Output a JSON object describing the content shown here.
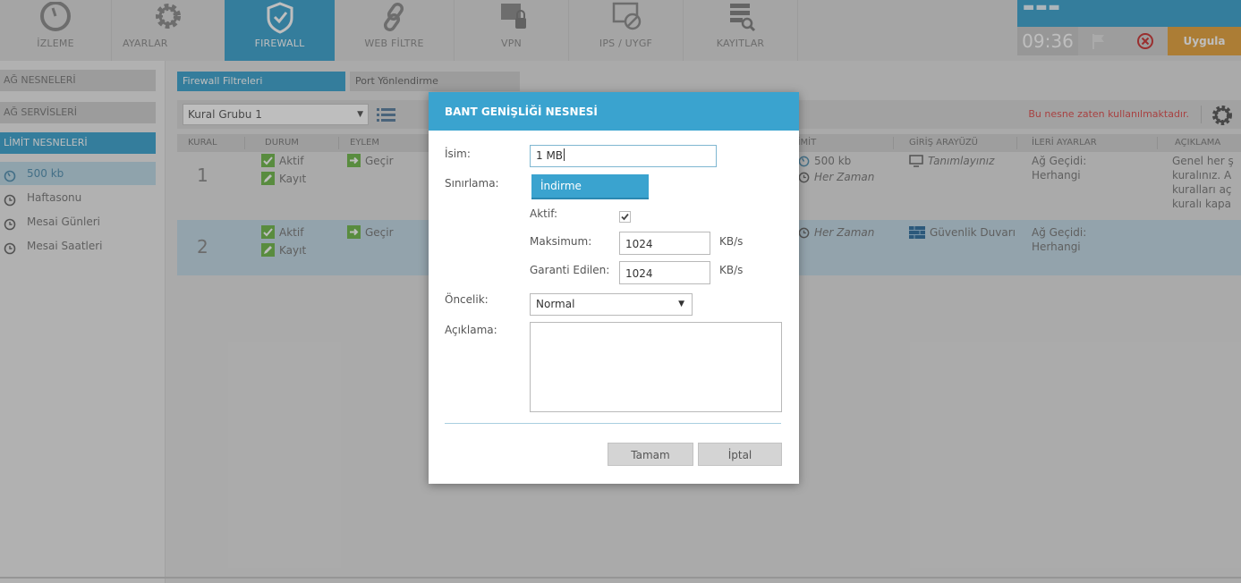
{
  "nav": {
    "tabs": [
      {
        "label": "İZLEME",
        "icon": "gauge-icon"
      },
      {
        "label": "AYARLAR",
        "icon": "gear-icon"
      },
      {
        "label": "FIREWALL",
        "icon": "shield-icon"
      },
      {
        "label": "WEB FİLTRE",
        "icon": "link-icon"
      },
      {
        "label": "VPN",
        "icon": "network-lock-icon"
      },
      {
        "label": "IPS / UYGF",
        "icon": "blocked-monitor-icon"
      },
      {
        "label": "KAYITLAR",
        "icon": "log-search-icon"
      }
    ],
    "active_tab": "FIREWALL",
    "time": "09:36",
    "apply_label": "Uygula",
    "colors": {
      "accent": "#3aa3cf",
      "apply": "#e6a33c",
      "warning": "#e04c4c"
    }
  },
  "sidebar": {
    "sections": [
      "AĞ NESNELERİ",
      "AĞ SERVİSLERİ",
      "LİMİT NESNELERİ"
    ],
    "active_section": "LİMİT NESNELERİ",
    "items": [
      {
        "label": "500 kb",
        "icon": "gauge-icon",
        "selected": true
      },
      {
        "label": "Haftasonu",
        "icon": "clock-icon",
        "selected": false
      },
      {
        "label": "Mesai Günleri",
        "icon": "clock-icon",
        "selected": false
      },
      {
        "label": "Mesai Saatleri",
        "icon": "clock-icon",
        "selected": false
      }
    ]
  },
  "main": {
    "tabs": [
      "Firewall Filtreleri",
      "Port Yönlendirme"
    ],
    "active_tab": "Firewall Filtreleri",
    "group_select": "Kural Grubu 1",
    "warning": "Bu nesne zaten kullanılmaktadır.",
    "columns": [
      "KURAL",
      "DURUM",
      "EYLEM",
      "LİMİT",
      "GİRİŞ ARAYÜZÜ",
      "İLERİ AYARLAR",
      "AÇIKLAMA"
    ],
    "rows": [
      {
        "num": "1",
        "status": "Aktif",
        "log": "Kayıt",
        "action": "Geçir",
        "limit": "500 kb",
        "schedule": "Her Zaman",
        "interface": "Tanımlayınız",
        "advanced_1": "Ağ Geçidi:",
        "advanced_2": "Herhangi",
        "desc": [
          "Genel her ş",
          "kuralınız. A",
          "kuralları aç",
          "kuralı kapa"
        ]
      },
      {
        "num": "2",
        "status": "Aktif",
        "log": "Kayıt",
        "action": "Geçir",
        "schedule": "Her Zaman",
        "interface": "Güvenlik Duvarı",
        "advanced_1": "Ağ Geçidi:",
        "advanced_2": "Herhangi"
      }
    ]
  },
  "modal": {
    "title": "BANT GENİŞLİĞİ NESNESİ",
    "name_label": "İsim:",
    "name_value": "1 MB",
    "limit_label": "Sınırlama:",
    "limit_option": "İndirme",
    "active_label": "Aktif:",
    "active_checked": true,
    "max_label": "Maksimum:",
    "max_value": "1024",
    "max_unit": "KB/s",
    "guarantee_label": "Garanti Edilen:",
    "guarantee_value": "1024",
    "guarantee_unit": "KB/s",
    "priority_label": "Öncelik:",
    "priority_value": "Normal",
    "desc_label": "Açıklama:",
    "desc_value": "",
    "ok_label": "Tamam",
    "cancel_label": "İptal"
  }
}
